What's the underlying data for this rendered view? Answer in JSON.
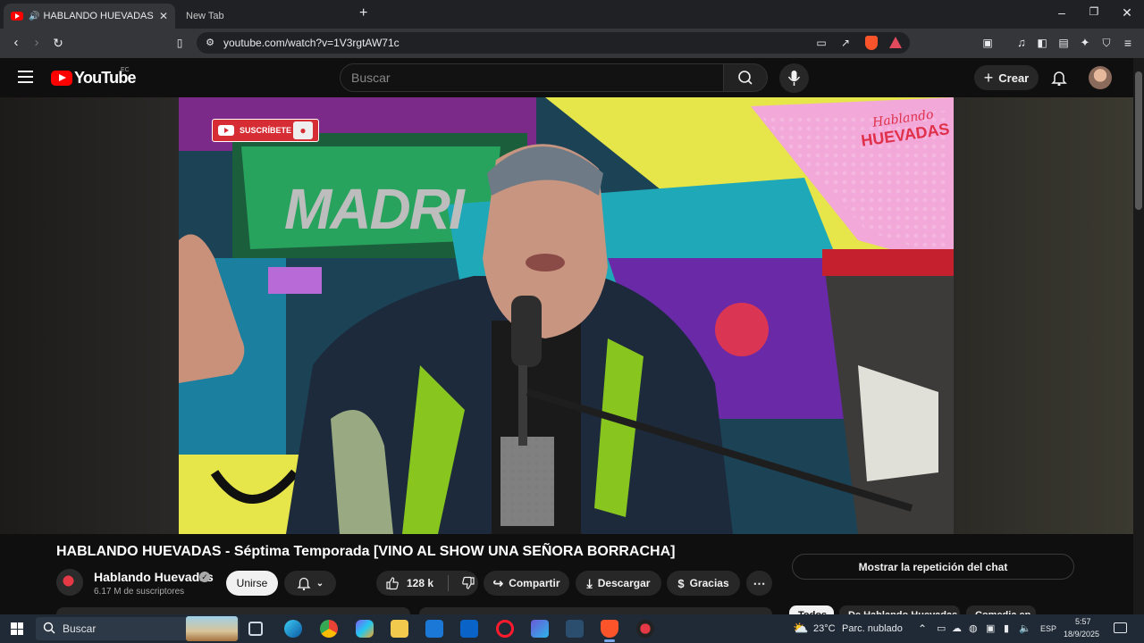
{
  "browser": {
    "tabs": [
      {
        "title": "HABLANDO HUEVADAS - Sé",
        "active": true
      },
      {
        "title": "New Tab",
        "active": false
      }
    ],
    "new_tab_symbol": "+",
    "url": "youtube.com/watch?v=1V3rgtAW71c",
    "window_controls": {
      "minimize": "–",
      "maximize": "❐",
      "close": "✕"
    }
  },
  "youtube": {
    "logo_text": "YouTube",
    "region": "EC",
    "search_placeholder": "Buscar",
    "create_label": "Crear"
  },
  "video": {
    "overlay_subscribe": "SUSCRÍBETE",
    "overlay_logo_line1": "Hablando",
    "overlay_logo_line2": "HUEVADAS",
    "sign_text": "MADRI"
  },
  "details": {
    "title": "HABLANDO HUEVADAS - Séptima Temporada [VINO AL SHOW UNA SEÑORA BORRACHA]",
    "channel_name": "Hablando Huevadas",
    "subscribers": "6.17 M de suscriptores",
    "join_label": "Unirse",
    "likes": "128 k",
    "share_label": "Compartir",
    "download_label": "Descargar",
    "thanks_label": "Gracias",
    "chat_replay_label": "Mostrar la repetición del chat",
    "chips": [
      "Todos",
      "De Hablando Huevadas",
      "Comedia en"
    ]
  },
  "taskbar": {
    "search_placeholder": "Buscar",
    "weather_temp": "23°C",
    "weather_desc": "Parc. nublado",
    "language": "ESP",
    "time": "5:57",
    "date": "18/9/2025"
  },
  "colors": {
    "youtube_red": "#ff0000",
    "page_bg": "#0f0f0f",
    "taskbar_bg": "#1f2a36"
  }
}
